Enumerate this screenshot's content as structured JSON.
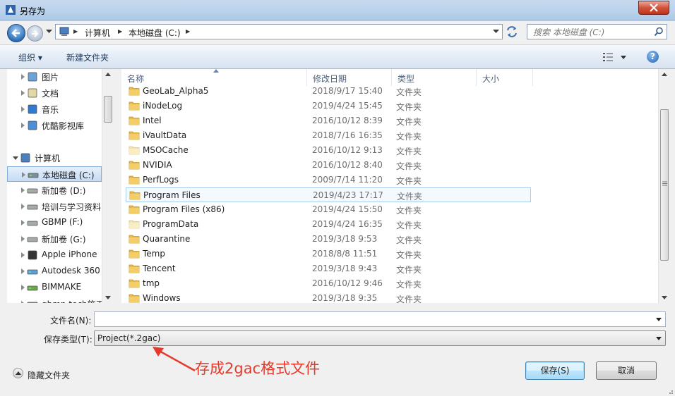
{
  "window": {
    "title": "另存为"
  },
  "address": {
    "crumbs": [
      "计算机",
      "本地磁盘 (C:)"
    ]
  },
  "search": {
    "placeholder": "搜索 本地磁盘 (C:)"
  },
  "toolbar": {
    "organize": "组织 ▾",
    "new_folder": "新建文件夹"
  },
  "nav": {
    "items": [
      {
        "label": "图片",
        "icon": "pictures-icon"
      },
      {
        "label": "文档",
        "icon": "documents-icon"
      },
      {
        "label": "音乐",
        "icon": "music-icon"
      },
      {
        "label": "优酷影视库",
        "icon": "video-library-icon"
      },
      {
        "label": "计算机",
        "icon": "computer-icon"
      },
      {
        "label": "本地磁盘 (C:)",
        "icon": "system-drive-icon"
      },
      {
        "label": "新加卷 (D:)",
        "icon": "drive-icon"
      },
      {
        "label": "培训与学习资料",
        "icon": "drive-icon"
      },
      {
        "label": "GBMP (F:)",
        "icon": "drive-icon"
      },
      {
        "label": "新加卷 (G:)",
        "icon": "drive-icon"
      },
      {
        "label": "Apple iPhone",
        "icon": "iphone-icon"
      },
      {
        "label": "Autodesk 360",
        "icon": "cloud-drive-icon"
      },
      {
        "label": "BIMMAKE",
        "icon": "network-drive-icon"
      },
      {
        "label": "gbmp.tech施工",
        "icon": "network-drive-icon"
      }
    ]
  },
  "columns": {
    "name": "名称",
    "modified": "修改日期",
    "type": "类型",
    "size": "大小"
  },
  "files": [
    {
      "name": "GeoLab_Alpha5",
      "modified": "2018/9/17 15:40",
      "type": "文件夹"
    },
    {
      "name": "iNodeLog",
      "modified": "2019/4/24 15:45",
      "type": "文件夹"
    },
    {
      "name": "Intel",
      "modified": "2016/10/12 8:39",
      "type": "文件夹"
    },
    {
      "name": "iVaultData",
      "modified": "2018/7/16 16:35",
      "type": "文件夹"
    },
    {
      "name": "MSOCache",
      "modified": "2016/10/12 9:13",
      "type": "文件夹"
    },
    {
      "name": "NVIDIA",
      "modified": "2016/10/12 8:40",
      "type": "文件夹"
    },
    {
      "name": "PerfLogs",
      "modified": "2009/7/14 11:20",
      "type": "文件夹"
    },
    {
      "name": "Program Files",
      "modified": "2019/4/23 17:17",
      "type": "文件夹"
    },
    {
      "name": "Program Files (x86)",
      "modified": "2019/4/24 15:50",
      "type": "文件夹"
    },
    {
      "name": "ProgramData",
      "modified": "2019/4/24 16:35",
      "type": "文件夹"
    },
    {
      "name": "Quarantine",
      "modified": "2019/3/18 9:53",
      "type": "文件夹"
    },
    {
      "name": "Temp",
      "modified": "2018/8/8 11:51",
      "type": "文件夹"
    },
    {
      "name": "Tencent",
      "modified": "2019/3/18 9:43",
      "type": "文件夹"
    },
    {
      "name": "tmp",
      "modified": "2016/10/12 9:46",
      "type": "文件夹"
    },
    {
      "name": "Windows",
      "modified": "2019/3/18 9:35",
      "type": "文件夹"
    }
  ],
  "form": {
    "filename_label": "文件名(N):",
    "filename_value": "",
    "filetype_label": "保存类型(T):",
    "filetype_value": "Project(*.2gac)"
  },
  "buttons": {
    "hide_folders": "隐藏文件夹",
    "save": "保存(S)",
    "cancel": "取消"
  },
  "annotation": {
    "text": "存成2gac格式文件",
    "color": "#e53a2b"
  },
  "colors": {
    "title_gradient": "#bcd3ec",
    "close_red": "#c7402a",
    "accent_blue": "#2e6fb8"
  }
}
